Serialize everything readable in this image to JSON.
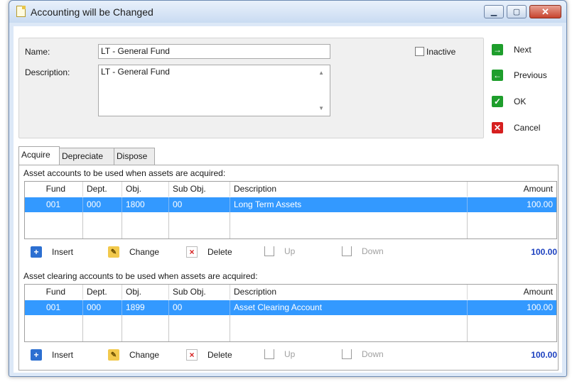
{
  "window": {
    "title": "Accounting will be Changed"
  },
  "form": {
    "name_label": "Name:",
    "name_value": "LT - General Fund",
    "description_label": "Description:",
    "description_value": "LT - General Fund",
    "inactive_label": "Inactive",
    "inactive_checked": false
  },
  "actions": {
    "next": "Next",
    "previous": "Previous",
    "ok": "OK",
    "cancel": "Cancel"
  },
  "tabs": [
    {
      "label": "Acquire",
      "active": true
    },
    {
      "label": "Depreciate",
      "active": false
    },
    {
      "label": "Dispose",
      "active": false
    }
  ],
  "columns": {
    "fund": "Fund",
    "dept": "Dept.",
    "obj": "Obj.",
    "subobj": "Sub Obj.",
    "description": "Description",
    "amount": "Amount"
  },
  "asset_section": {
    "caption": "Asset accounts to be used when assets are acquired:",
    "rows": [
      {
        "fund": "001",
        "dept": "000",
        "obj": "1800",
        "subobj": "00",
        "description": "Long Term Assets",
        "amount": "100.00"
      }
    ],
    "total": "100.00"
  },
  "clearing_section": {
    "caption": "Asset clearing accounts to be used when assets are acquired:",
    "rows": [
      {
        "fund": "001",
        "dept": "000",
        "obj": "1899",
        "subobj": "00",
        "description": "Asset Clearing Account",
        "amount": "100.00"
      }
    ],
    "total": "100.00"
  },
  "toolbar": {
    "insert": "Insert",
    "change": "Change",
    "delete": "Delete",
    "up": "Up",
    "down": "Down"
  },
  "colors": {
    "selection": "#3399ff",
    "total_text": "#1a3fbf",
    "ok_green": "#1e9e2c",
    "cancel_red": "#d61f1f"
  }
}
